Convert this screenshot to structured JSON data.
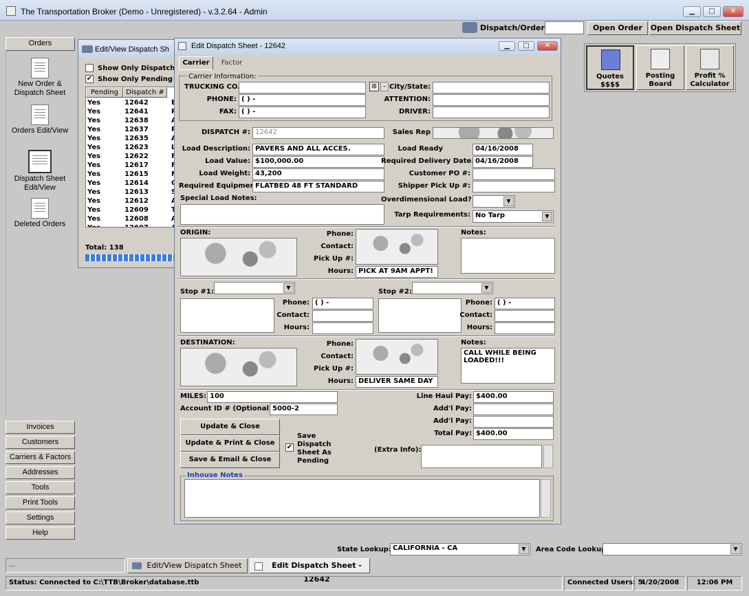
{
  "window": {
    "title": "The Transportation Broker (Demo - Unregistered) - v.3.2.64 - Admin"
  },
  "toolbar": {
    "dispatch_label": "Dispatch/Order #:",
    "dispatch_value": "",
    "open_order": "Open Order",
    "open_dispatch": "Open Dispatch Sheet"
  },
  "sidebar": {
    "header": "Orders",
    "nav": [
      "New Order & Dispatch Sheet",
      "Orders Edit/View",
      "Dispatch Sheet Edit/View",
      "Deleted Orders"
    ],
    "buttons": [
      "Invoices",
      "Customers",
      "Carriers & Factors",
      "Addresses",
      "Tools",
      "Print Tools",
      "Settings",
      "Help"
    ]
  },
  "quick": {
    "quotes": "Quotes $$$$",
    "posting": "Posting Board",
    "profit": "Profit % Calculator"
  },
  "bg_window": {
    "title": "Edit/View Dispatch Sh",
    "chk1": "Show Only Dispatch Sh",
    "chk2": "Show Only Pending Di",
    "col_pending": "Pending",
    "col_dispatch": "Dispatch #",
    "rows": [
      [
        "Yes",
        "12642",
        "E"
      ],
      [
        "Yes",
        "12641",
        "P"
      ],
      [
        "Yes",
        "12638",
        "A"
      ],
      [
        "Yes",
        "12637",
        "P"
      ],
      [
        "Yes",
        "12635",
        "A"
      ],
      [
        "Yes",
        "12623",
        "L"
      ],
      [
        "Yes",
        "12622",
        "F"
      ],
      [
        "Yes",
        "12617",
        "F"
      ],
      [
        "Yes",
        "12615",
        "N"
      ],
      [
        "Yes",
        "12614",
        "C"
      ],
      [
        "Yes",
        "12613",
        "S"
      ],
      [
        "Yes",
        "12612",
        "A"
      ],
      [
        "Yes",
        "12609",
        "T"
      ],
      [
        "Yes",
        "12608",
        "A"
      ],
      [
        "Yes",
        "12607",
        "A"
      ]
    ],
    "total": "Total: 138"
  },
  "dialog": {
    "title": "Edit Dispatch Sheet - 12642",
    "tab_carrier": "Carrier",
    "tab_factor": "Factor",
    "carrier_info": "Carrier Information:",
    "trucking": "TRUCKING CO.:",
    "phone": "PHONE:",
    "fax": "FAX:",
    "phone_val": "(  )   -",
    "fax_val": "(  )   -",
    "city": "City/State:",
    "attention": "ATTENTION:",
    "driver": "DRIVER:",
    "dispatch_no": "DISPATCH #:",
    "dispatch_val": "12642",
    "sales_rep": "Sales Rep",
    "load_desc": "Load Description:",
    "load_desc_val": "PAVERS AND ALL ACCES.",
    "load_value": "Load Value:",
    "load_value_val": "$100,000.00",
    "load_weight": "Load Weight:",
    "load_weight_val": "43,200",
    "req_equip": "Required Equipment:",
    "req_equip_val": "FLATBED 48 FT STANDARD",
    "special": "Special Load Notes:",
    "load_ready": "Load Ready",
    "load_ready_val": "04/16/2008",
    "req_delivery": "Required Delivery Date:",
    "req_delivery_val": "04/16/2008",
    "cust_po": "Customer PO #:",
    "shipper_pu": "Shipper Pick Up #:",
    "overdim": "Overdimensional Load?",
    "tarp": "Tarp Requirements:",
    "tarp_val": "No Tarp",
    "origin": "ORIGIN:",
    "phone2": "Phone:",
    "contact": "Contact:",
    "pickup": "Pick Up #:",
    "hours": "Hours:",
    "origin_hours": "PICK AT 9AM APPT!",
    "notes": "Notes:",
    "stop1": "Stop #1:",
    "stop2": "Stop #2:",
    "destination": "DESTINATION:",
    "dest_hours": "DELIVER SAME DAY",
    "dest_notes": "CALL WHILE BEING LOADED!!!",
    "miles": "MILES:",
    "miles_val": "100",
    "account": "Account ID # (Optional):",
    "account_val": "5000-2",
    "line_haul": "Line Haul Pay:",
    "line_haul_val": "$400.00",
    "addl": "Add'l Pay:",
    "total_pay": "Total Pay:",
    "total_val": "$400.00",
    "update_close": "Update & Close",
    "update_print": "Update & Print & Close",
    "save_email": "Save & Email & Close",
    "save_pending": "Save Dispatch Sheet As Pending",
    "extra": "(Extra Info):",
    "inhouse": "Inhouse Notes"
  },
  "bottom": {
    "state_label": "State Lookup:",
    "state_val": "CALIFORNIA - CA",
    "area_label": "Area Code Lookup:",
    "task_dots": "...",
    "task1": "Edit/View Dispatch Sheet",
    "task2": "Edit Dispatch Sheet - 12642",
    "status": "Status: Connected to C:\\TTB\\Broker\\database.ttb",
    "users": "Connected Users: 5",
    "date": "4/20/2008",
    "time": "12:06 PM"
  }
}
